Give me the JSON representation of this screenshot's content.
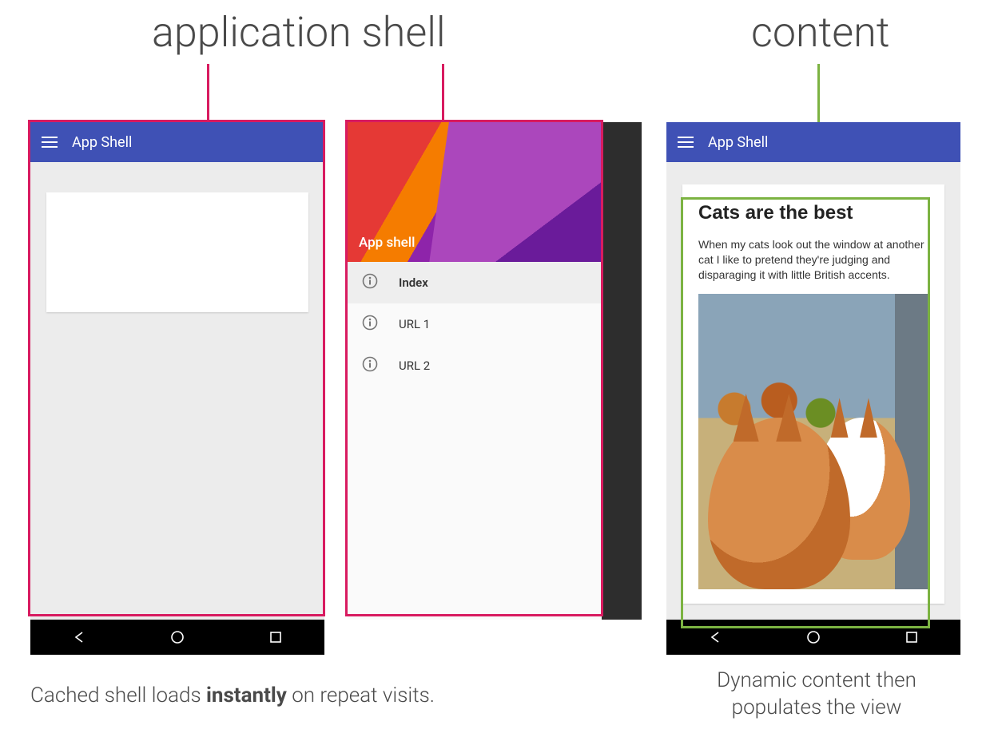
{
  "headings": {
    "app_shell": "application shell",
    "content": "content"
  },
  "colors": {
    "accent_pink": "#d81b60",
    "accent_green": "#7cb342",
    "toolbar_blue": "#3f51b5"
  },
  "appbar": {
    "title": "App Shell"
  },
  "drawer": {
    "hero_label": "App shell",
    "items": [
      {
        "label": "Index",
        "active": true
      },
      {
        "label": "URL 1",
        "active": false
      },
      {
        "label": "URL 2",
        "active": false
      }
    ]
  },
  "content_card": {
    "title": "Cats are the best",
    "body": "When my cats look out the window at another cat I like to pretend they're judging and disparaging it with little British accents.",
    "image_alt": "two-cats-looking-out-window"
  },
  "captions": {
    "left_pre": "Cached shell loads ",
    "left_strong": "instantly",
    "left_post": " on repeat visits.",
    "right": "Dynamic content then populates the view"
  }
}
